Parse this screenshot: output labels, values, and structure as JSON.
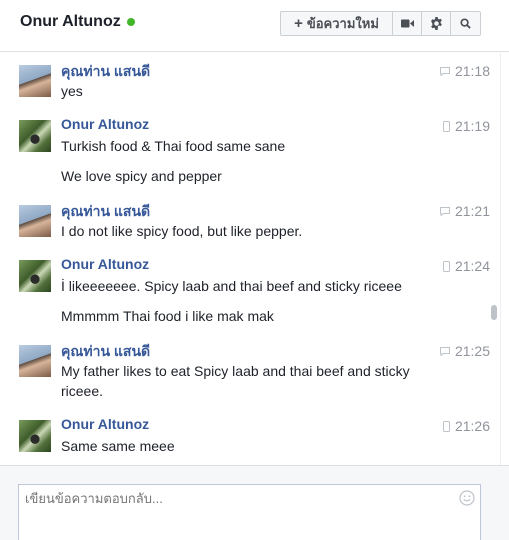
{
  "header": {
    "title": "Onur Altunoz",
    "new_message_label": "ข้อความใหม่"
  },
  "composer": {
    "placeholder": "เขียนข้อความตอบกลับ..."
  },
  "messages": [
    {
      "sender": "คุณท่าน แสนดี",
      "time": "21:18",
      "texts": [
        "yes"
      ]
    },
    {
      "sender": "Onur Altunoz",
      "time": "21:19",
      "texts": [
        "Turkish food & Thai food same sane",
        "We love spicy and pepper"
      ]
    },
    {
      "sender": "คุณท่าน แสนดี",
      "time": "21:21",
      "texts": [
        "I do not like spicy food, but like pepper."
      ]
    },
    {
      "sender": "Onur Altunoz",
      "time": "21:24",
      "texts": [
        "İ likeeeeeee.  Spicy laab and thai beef and sticky riceee",
        "Mmmmm Thai food i like mak mak"
      ]
    },
    {
      "sender": "คุณท่าน แสนดี",
      "time": "21:25",
      "texts": [
        "My father likes to eat Spicy laab and thai beef and sticky riceee."
      ]
    },
    {
      "sender": "Onur Altunoz",
      "time": "21:26",
      "texts": [
        "Same same meee"
      ]
    }
  ]
}
